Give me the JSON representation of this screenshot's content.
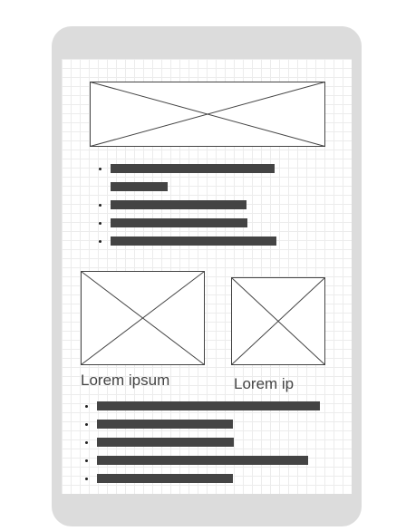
{
  "mockup": {
    "frame_color": "#dcdcdc",
    "grid_color": "#ececec",
    "bar_color": "#444444",
    "placeholder_kind": "image-placeholder-x",
    "hero_image": {
      "kind": "image-placeholder-x"
    },
    "list_top": {
      "item_count": 5
    },
    "cards": [
      {
        "caption": "Lorem ipsum",
        "image": "image-placeholder-x"
      },
      {
        "caption": "Lorem ip",
        "image": "image-placeholder-x"
      }
    ],
    "list_bottom": {
      "item_count": 5
    }
  }
}
